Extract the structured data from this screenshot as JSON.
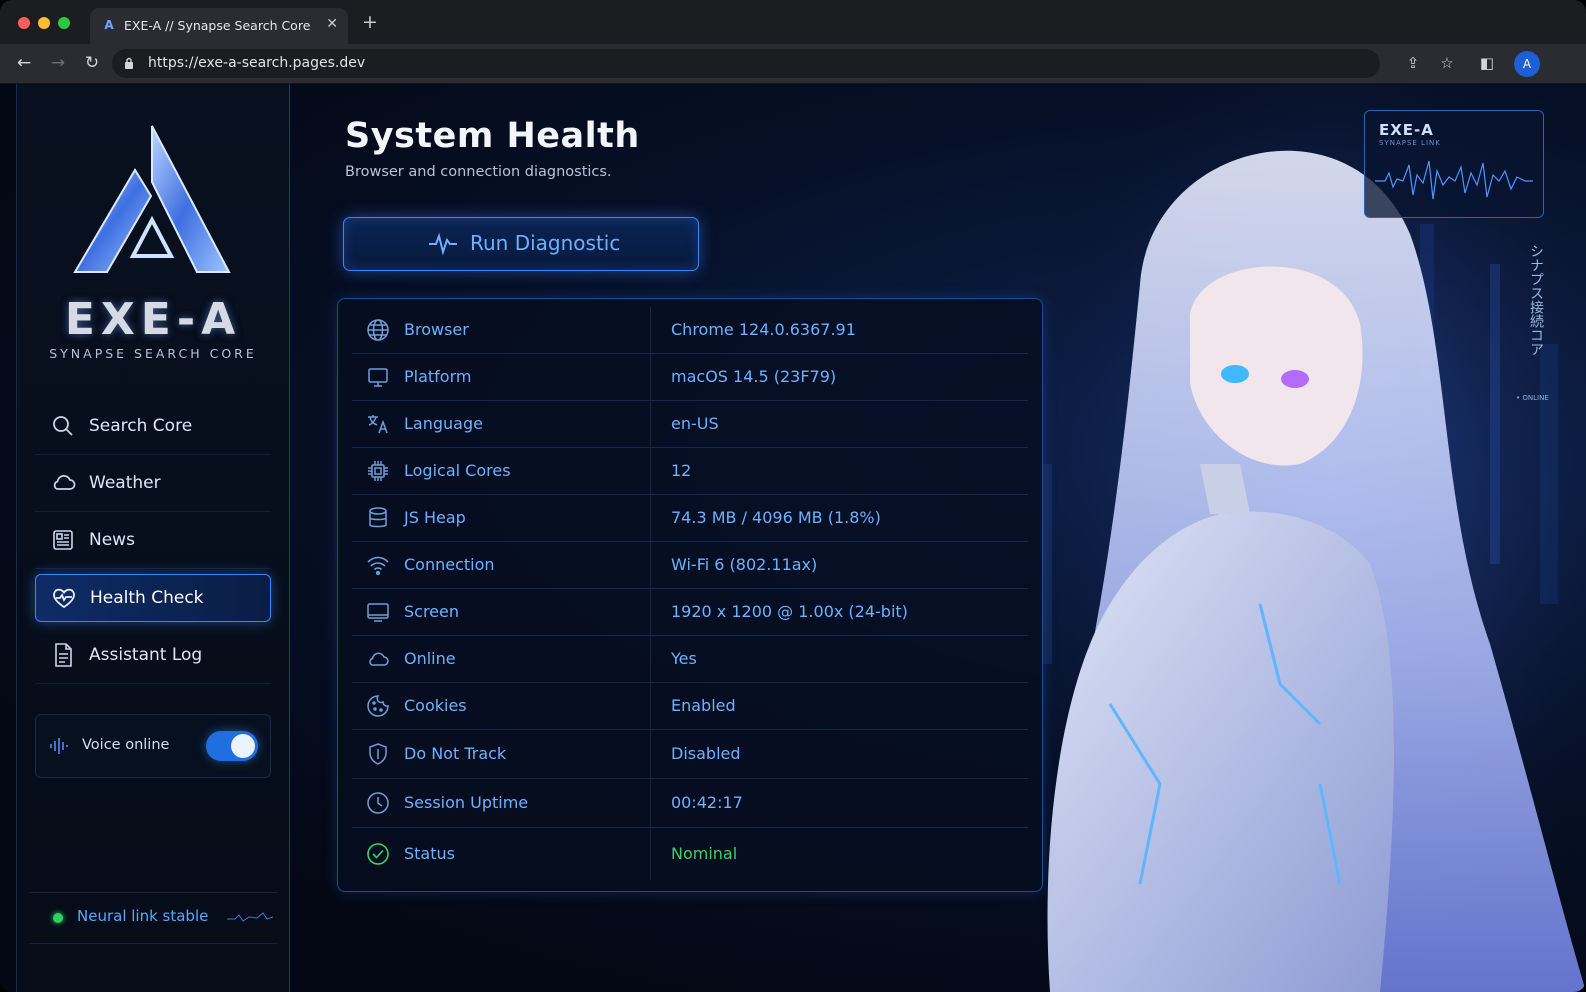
{
  "browser": {
    "tab_title": "EXE-A // Synapse Search Core",
    "tab_icon": "exe-a-logo-icon",
    "url": "https://exe-a-search.pages.dev",
    "avatar_initial": "A"
  },
  "sidebar": {
    "brand": "EXE-A",
    "tagline": "SYNAPSE SEARCH CORE",
    "items": [
      {
        "label": "Search Core",
        "icon": "search-icon",
        "active": false
      },
      {
        "label": "Weather",
        "icon": "cloud-icon",
        "active": false
      },
      {
        "label": "News",
        "icon": "newspaper-icon",
        "active": false
      },
      {
        "label": "Health Check",
        "icon": "heart-pulse-icon",
        "active": true
      },
      {
        "label": "Assistant Log",
        "icon": "document-icon",
        "active": false
      }
    ],
    "voice": {
      "label": "Voice online",
      "enabled": true
    },
    "link_status": "Neural link stable"
  },
  "main": {
    "title": "System Health",
    "subtitle": "Browser and connection diagnostics.",
    "run_button": "Run Diagnostic",
    "rows": [
      {
        "key": "Browser",
        "value": "Chrome 124.0.6367.91",
        "icon": "globe-icon"
      },
      {
        "key": "Platform",
        "value": "macOS 14.5 (23F79)",
        "icon": "monitor-icon"
      },
      {
        "key": "Language",
        "value": "en-US",
        "icon": "translate-icon"
      },
      {
        "key": "Logical Cores",
        "value": "12",
        "icon": "cpu-icon"
      },
      {
        "key": "JS Heap",
        "value": "74.3 MB / 4096 MB (1.8%)",
        "icon": "database-icon"
      },
      {
        "key": "Connection",
        "value": "Wi-Fi 6 (802.11ax)",
        "icon": "wifi-icon"
      },
      {
        "key": "Screen",
        "value": "1920 x 1200 @ 1.00x (24-bit)",
        "icon": "screen-icon"
      },
      {
        "key": "Online",
        "value": "Yes",
        "icon": "cloud-icon"
      },
      {
        "key": "Cookies",
        "value": "Enabled",
        "icon": "cookie-icon"
      },
      {
        "key": "Do Not Track",
        "value": "Disabled",
        "icon": "shield-icon"
      },
      {
        "key": "Session Uptime",
        "value": "00:42:17",
        "icon": "clock-icon"
      },
      {
        "key": "Status",
        "value": "Nominal",
        "icon": "check-circle-icon"
      }
    ]
  },
  "hero": {
    "hud_title": "EXE-A",
    "hud_sub": "SYNAPSE LINK",
    "vertical_text": "シナプス接続コア",
    "online_tag": "• ONLINE"
  },
  "colors": {
    "accent": "#3c84ff",
    "value_text": "#6cb2ff",
    "ok": "#3bd166"
  }
}
